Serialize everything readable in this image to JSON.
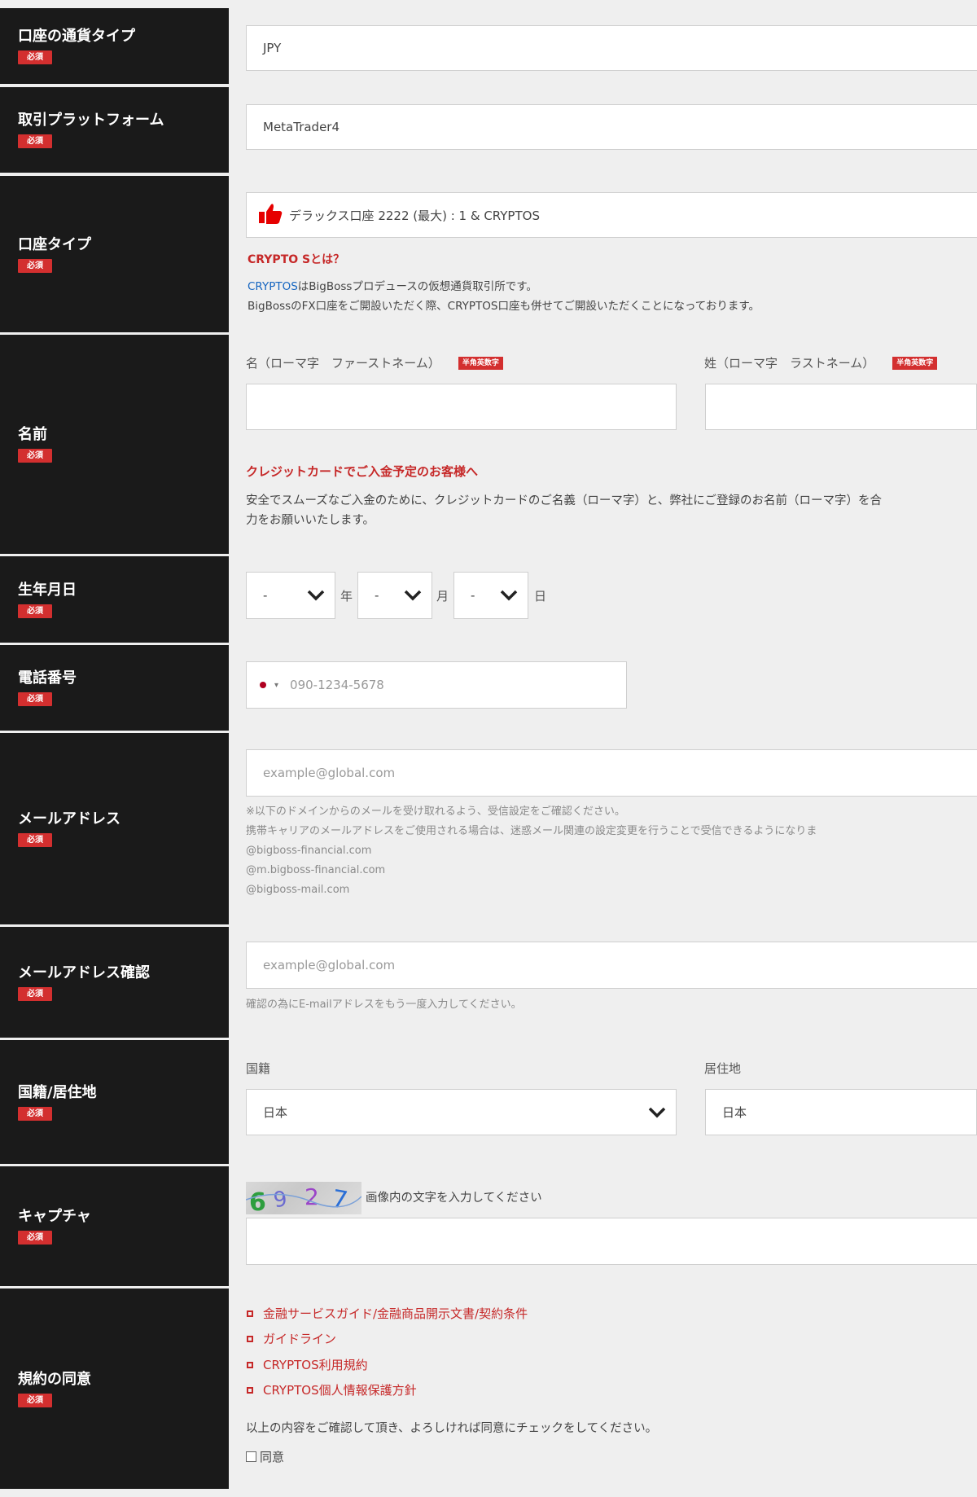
{
  "rows": {
    "currency": {
      "label": "口座の通貨タイプ",
      "badge": "必須",
      "value": "JPY"
    },
    "platform": {
      "label": "取引プラットフォーム",
      "badge": "必須",
      "value": "MetaTrader4"
    },
    "account_type": {
      "label": "口座タイプ",
      "badge": "必須",
      "value": "デラックス口座 2222 (最大) : 1 & CRYPTOS",
      "crypto_heading": "CRYPTO Sとは？",
      "crypto_link": "CRYPTOS",
      "crypto_line1_rest": "はBigBossプロデュースの仮想通貨取引所です。",
      "crypto_line2": "BigBossのFX口座をご開設いただく際、CRYPTOS口座も併せてご開設いただくことになっております。"
    },
    "name": {
      "label": "名前",
      "badge": "必須",
      "first_label": "名（ローマ字　ファーストネーム）",
      "last_label": "姓（ローマ字　ラストネーム）",
      "hankaku_badge": "半角英数字",
      "first_value": "",
      "last_value": "",
      "card_heading": "クレジットカードでご入金予定のお客様へ",
      "card_line1": "安全でスムーズなご入金のために、クレジットカードのご名義（ローマ字）と、弊社にご登録のお名前（ローマ字）を合",
      "card_line2": "力をお願いいたします。"
    },
    "birthdate": {
      "label": "生年月日",
      "badge": "必須",
      "year_value": "-",
      "month_value": "-",
      "day_value": "-",
      "year_unit": "年",
      "month_unit": "月",
      "day_unit": "日"
    },
    "phone": {
      "label": "電話番号",
      "badge": "必須",
      "placeholder": "090-1234-5678"
    },
    "email": {
      "label": "メールアドレス",
      "badge": "必須",
      "placeholder": "example@global.com",
      "note1": "※以下のドメインからのメールを受け取れるよう、受信設定をご確認ください。",
      "note2": "携帯キャリアのメールアドレスをご使用される場合は、迷惑メール関連の設定変更を行うことで受信できるようになりま",
      "domain1": "@bigboss-financial.com",
      "domain2": "@m.bigboss-financial.com",
      "domain3": "@bigboss-mail.com"
    },
    "email_confirm": {
      "label": "メールアドレス確認",
      "badge": "必須",
      "placeholder": "example@global.com",
      "note": "確認の為にE-mailアドレスをもう一度入力してください。"
    },
    "country": {
      "label": "国籍/居住地",
      "badge": "必須",
      "nationality_label": "国籍",
      "residence_label": "居住地",
      "nationality_value": "日本",
      "residence_value": "日本"
    },
    "captcha": {
      "label": "キャプチャ",
      "badge": "必須",
      "image_text": "6927",
      "instruction": "画像内の文字を入力してください",
      "value": ""
    },
    "terms": {
      "label": "規約の同意",
      "badge": "必須",
      "links": [
        "金融サービスガイド/金融商品開示文書/契約条件",
        "ガイドライン",
        "CRYPTOS利用規約",
        "CRYPTOS個人情報保護方針"
      ],
      "confirm_text": "以上の内容をご確認して頂き、よろしければ同意にチェックをしてください。",
      "agree_label": "同意"
    }
  },
  "colors": {
    "label_bg": "#1a1a1a",
    "badge_red": "#d32f2f",
    "accent_red": "#c62828",
    "link_blue": "#1565c0"
  },
  "icons": {
    "thumbs_up": "thumbs-up-icon",
    "chevron": "chevron-down-icon",
    "flag": "japan-flag-icon"
  }
}
